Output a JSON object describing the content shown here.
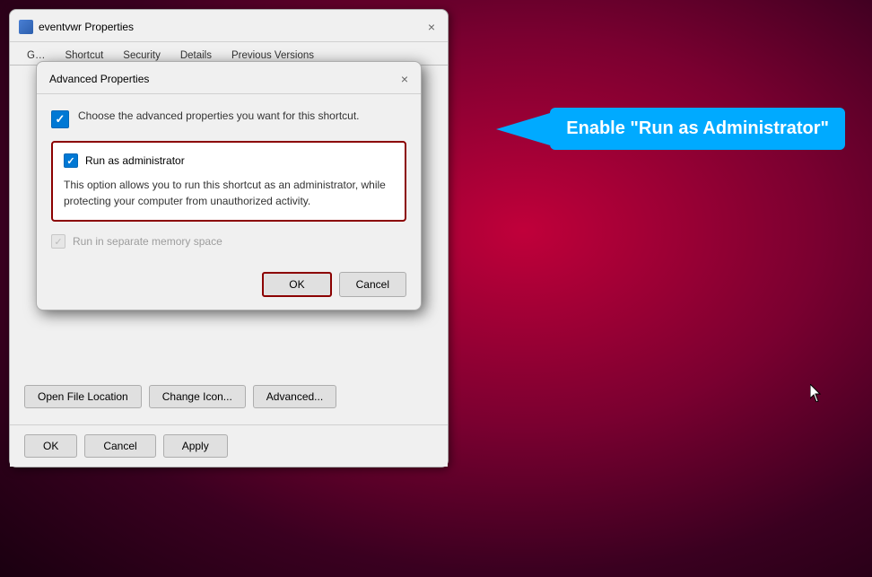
{
  "mainWindow": {
    "title": "eventvwr Properties",
    "closeLabel": "×",
    "tabs": [
      "General",
      "Shortcut",
      "Security",
      "Details",
      "Previous Versions"
    ],
    "bodyButtons": {
      "openFileLocation": "Open File Location",
      "changeIcon": "Change Icon...",
      "advanced": "Advanced..."
    },
    "bottomButtons": {
      "ok": "OK",
      "cancel": "Cancel",
      "apply": "Apply"
    }
  },
  "advDialog": {
    "title": "Advanced Properties",
    "closeLabel": "×",
    "descriptionText": "Choose the advanced properties you want for this shortcut.",
    "runAsAdmin": {
      "label": "Run as administrator",
      "description": "This option allows you to run this shortcut as an administrator, while protecting your computer from unauthorized activity."
    },
    "separateMemory": {
      "label": "Run in separate memory space"
    },
    "buttons": {
      "ok": "OK",
      "cancel": "Cancel"
    }
  },
  "callout": {
    "text": "Enable \"Run as Administrator\""
  }
}
